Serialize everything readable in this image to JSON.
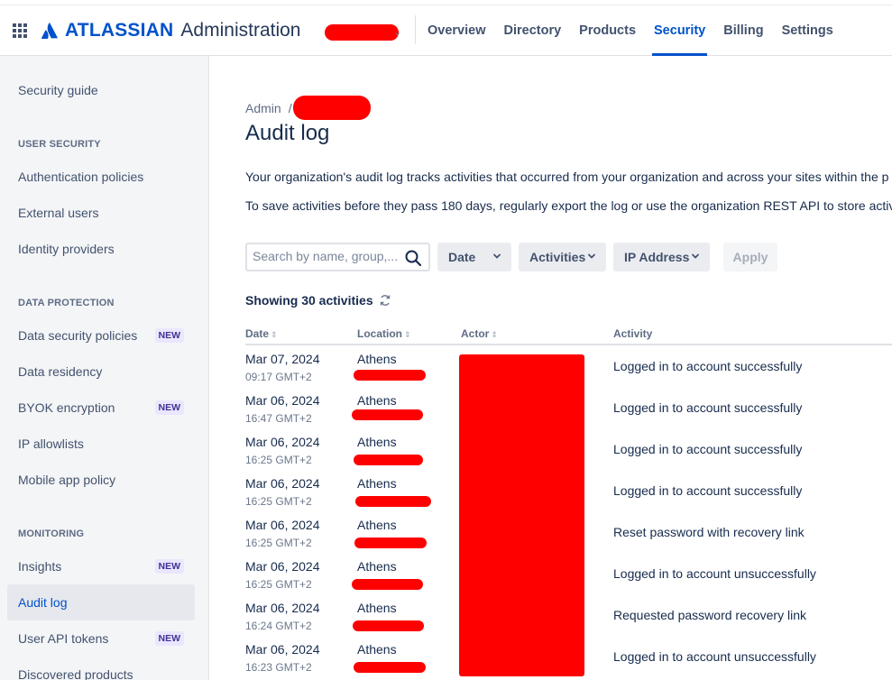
{
  "header": {
    "brand_name": "ATLASSIAN",
    "brand_sub": "Administration",
    "nav": [
      {
        "label": "Overview"
      },
      {
        "label": "Directory"
      },
      {
        "label": "Products"
      },
      {
        "label": "Security",
        "active": true
      },
      {
        "label": "Billing"
      },
      {
        "label": "Settings"
      }
    ],
    "accent_color": "#0052cc",
    "redaction_color": "#ff0000"
  },
  "sidebar": {
    "top_link": "Security guide",
    "sections": [
      {
        "heading": "USER SECURITY",
        "items": [
          {
            "label": "Authentication policies"
          },
          {
            "label": "External users"
          },
          {
            "label": "Identity providers"
          }
        ]
      },
      {
        "heading": "DATA PROTECTION",
        "items": [
          {
            "label": "Data security policies",
            "badge": "NEW"
          },
          {
            "label": "Data residency"
          },
          {
            "label": "BYOK encryption",
            "badge": "NEW"
          },
          {
            "label": "IP allowlists"
          },
          {
            "label": "Mobile app policy"
          }
        ]
      },
      {
        "heading": "MONITORING",
        "items": [
          {
            "label": "Insights",
            "badge": "NEW"
          },
          {
            "label": "Audit log",
            "active": true
          },
          {
            "label": "User API tokens",
            "badge": "NEW"
          },
          {
            "label": "Discovered products"
          }
        ]
      }
    ]
  },
  "main": {
    "breadcrumb": {
      "root": "Admin",
      "separator": "/"
    },
    "title": "Audit log",
    "description_1": "Your organization's audit log tracks activities that occurred from your organization and across your sites within the p",
    "description_2": "To save activities before they pass 180 days, regularly export the log or use the organization REST API to store activit",
    "filters": {
      "search_placeholder": "Search by name, group,...",
      "date_label": "Date",
      "activities_label": "Activities",
      "ip_label": "IP Address",
      "apply_label": "Apply"
    },
    "showing": "Showing 30 activities",
    "columns": {
      "date": "Date",
      "location": "Location",
      "actor": "Actor",
      "activity": "Activity"
    },
    "rows": [
      {
        "date": "Mar 07, 2024",
        "time": "09:17 GMT+2",
        "location": "Athens",
        "activity": "Logged in to account successfully"
      },
      {
        "date": "Mar 06, 2024",
        "time": "16:47 GMT+2",
        "location": "Athens",
        "activity": "Logged in to account successfully"
      },
      {
        "date": "Mar 06, 2024",
        "time": "16:25 GMT+2",
        "location": "Athens",
        "activity": "Logged in to account successfully"
      },
      {
        "date": "Mar 06, 2024",
        "time": "16:25 GMT+2",
        "location": "Athens",
        "activity": "Logged in to account successfully"
      },
      {
        "date": "Mar 06, 2024",
        "time": "16:25 GMT+2",
        "location": "Athens",
        "activity": "Reset password with recovery link"
      },
      {
        "date": "Mar 06, 2024",
        "time": "16:25 GMT+2",
        "location": "Athens",
        "activity": "Logged in to account unsuccessfully"
      },
      {
        "date": "Mar 06, 2024",
        "time": "16:24 GMT+2",
        "location": "Athens",
        "activity": "Requested password recovery link"
      },
      {
        "date": "Mar 06, 2024",
        "time": "16:23 GMT+2",
        "location": "Athens",
        "activity": "Logged in to account unsuccessfully"
      }
    ]
  }
}
